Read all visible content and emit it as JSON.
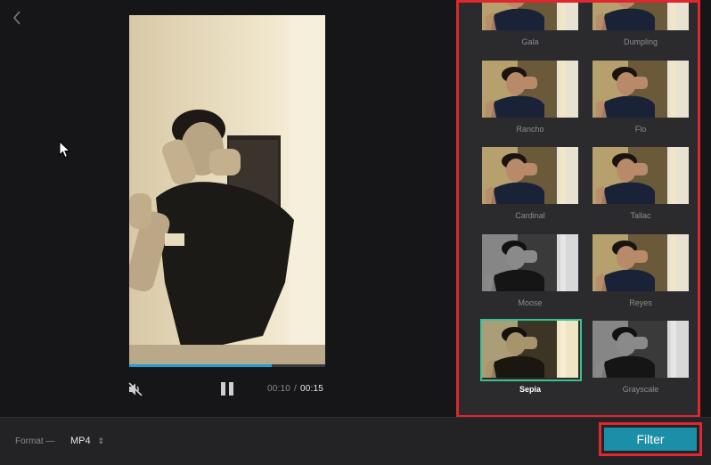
{
  "player": {
    "current_time": "00:10",
    "separator": "/",
    "total_time": "00:15",
    "progress": 0.727
  },
  "filters": [
    {
      "label": "Gala",
      "tone": "color"
    },
    {
      "label": "Dumpling",
      "tone": "color"
    },
    {
      "label": "Rancho",
      "tone": "color"
    },
    {
      "label": "Flo",
      "tone": "color"
    },
    {
      "label": "Cardinal",
      "tone": "color"
    },
    {
      "label": "Tallac",
      "tone": "color"
    },
    {
      "label": "Moose",
      "tone": "gray"
    },
    {
      "label": "Reyes",
      "tone": "color"
    },
    {
      "label": "Sepia",
      "tone": "sepia",
      "selected": true
    },
    {
      "label": "Grayscale",
      "tone": "gray"
    }
  ],
  "bottom_bar": {
    "format_label": "Format —",
    "format_value": "MP4",
    "filter_button": "Filter"
  },
  "colors": {
    "accent": "#1b8fa8",
    "progress": "#1e9fd6",
    "selected_border": "#3bc28f",
    "highlight": "#e0262e"
  }
}
